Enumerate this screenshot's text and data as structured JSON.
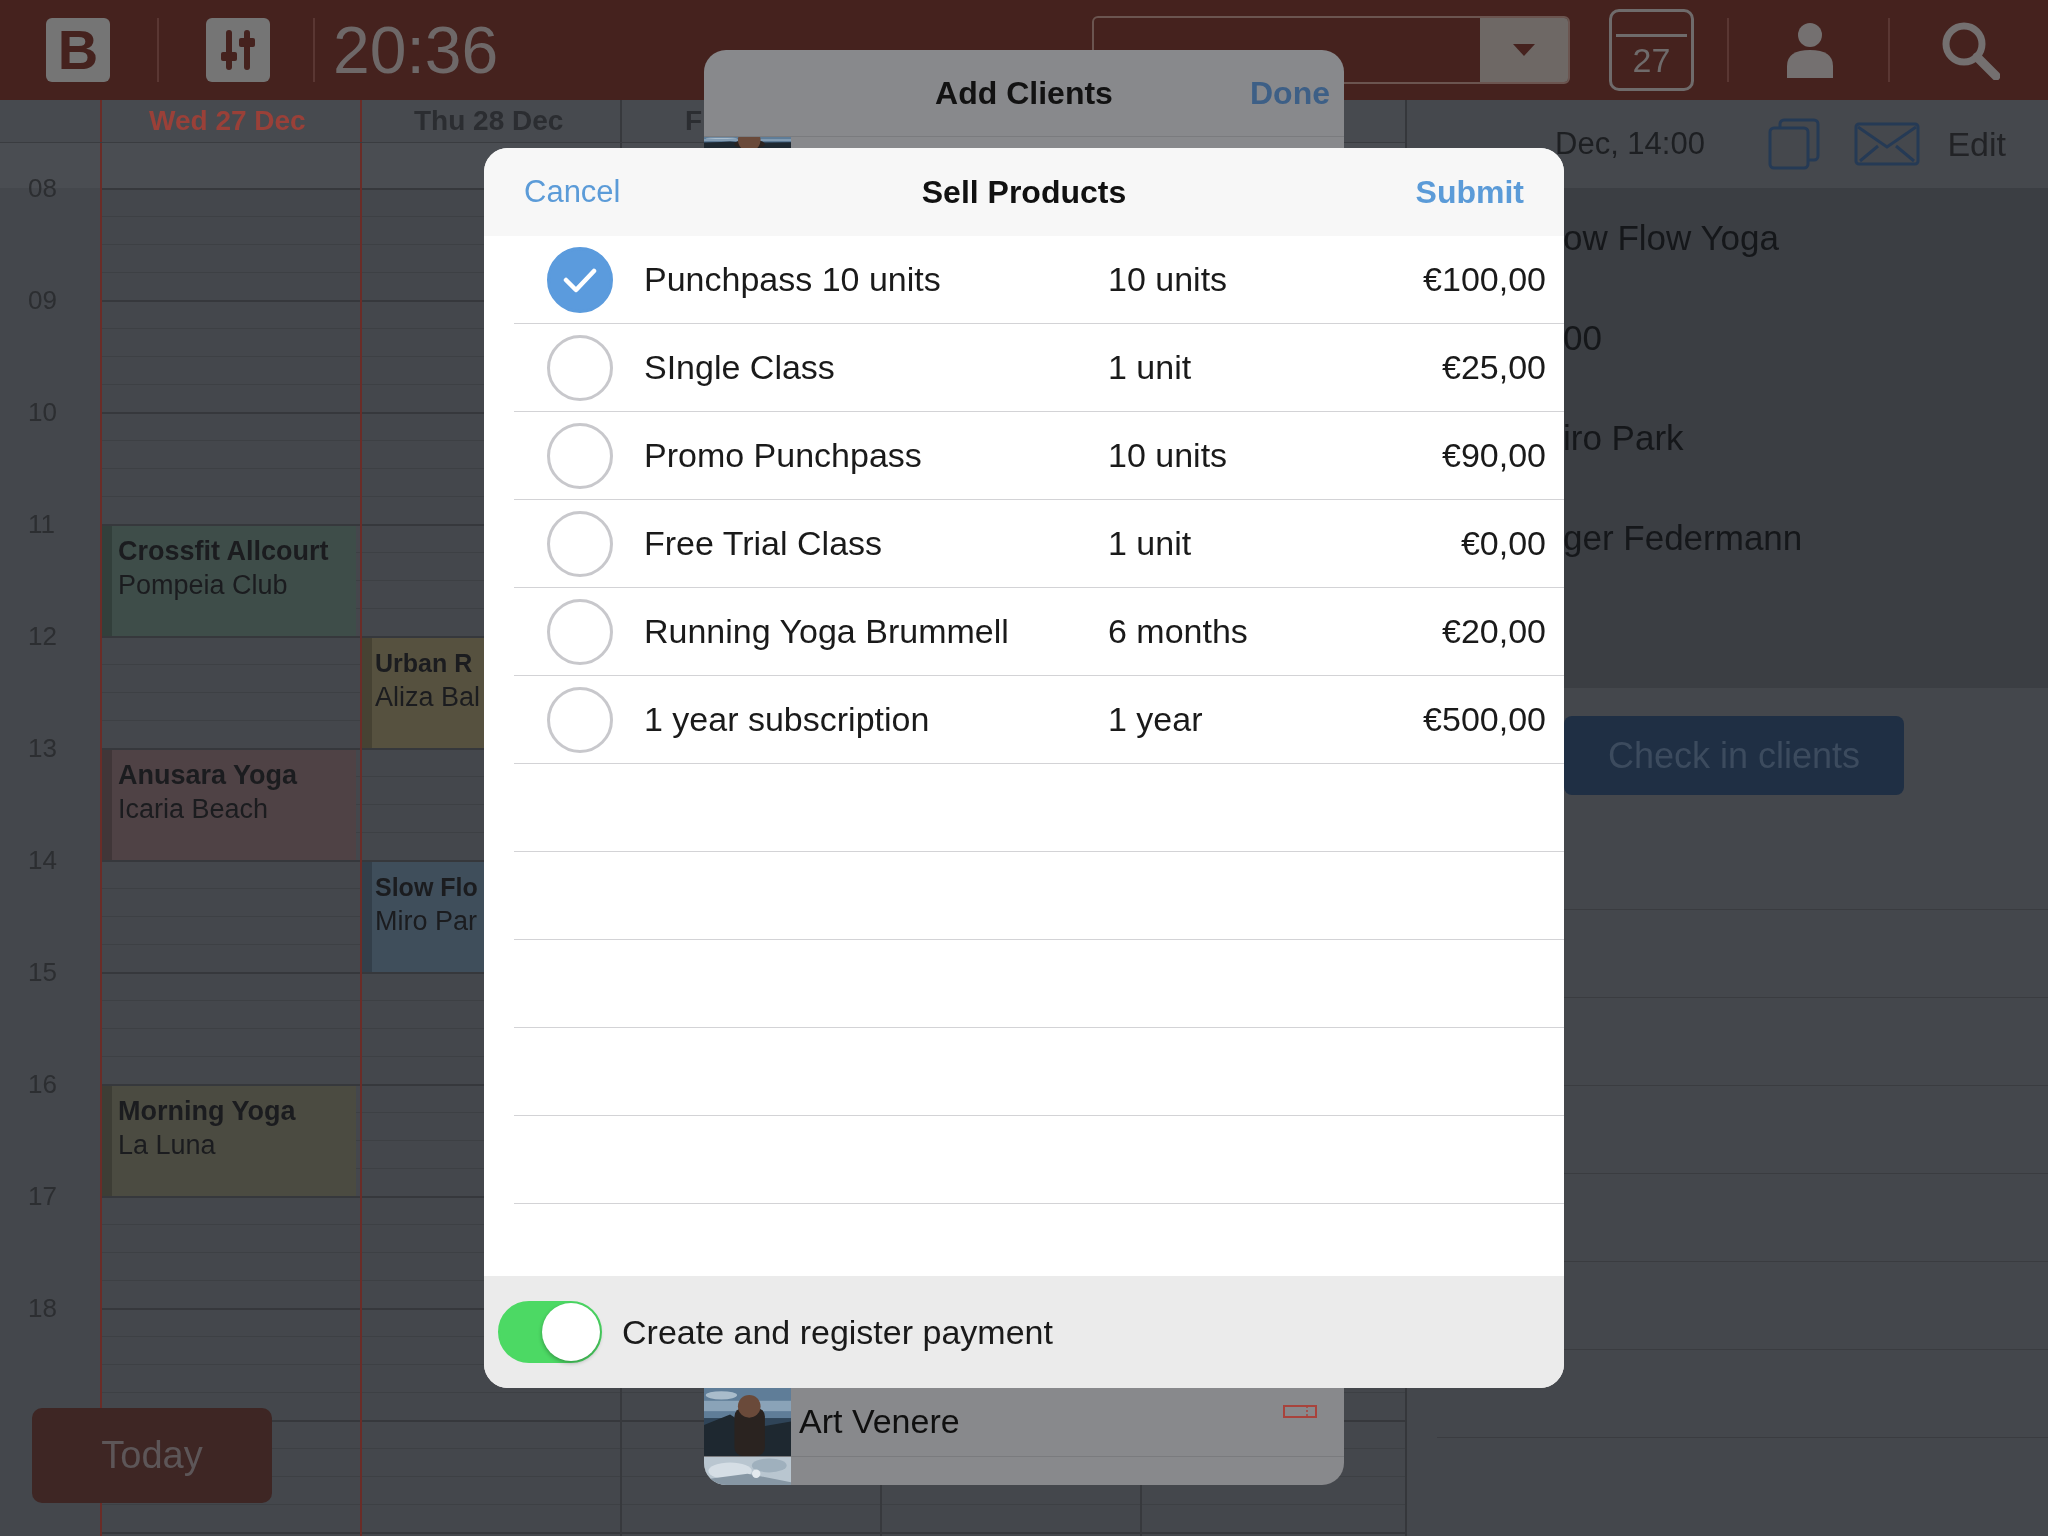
{
  "top_bar": {
    "logo_letter": "B",
    "time": "20:36",
    "calendar_day": "27"
  },
  "calendar": {
    "days": [
      {
        "label": "Wed 27 Dec",
        "today": true,
        "events": [
          {
            "title": "Crossfit Allcourt",
            "place": "Pompeia Club",
            "color": "#3e4d49"
          },
          {
            "title": "Anusara Yoga",
            "place": "Icaria Beach",
            "color": "#4f4245"
          },
          {
            "title": "Morning Yoga",
            "place": "La Luna",
            "color": "#4b4b41"
          }
        ]
      },
      {
        "label": "Thu 28 Dec",
        "today": false,
        "events": [
          {
            "title": "Urban R",
            "place": "Aliza Bal",
            "color": "#56513f"
          },
          {
            "title": "Slow Flo",
            "place": "Miro Par",
            "color": "#3f4e5b"
          }
        ]
      },
      {
        "label": "F",
        "today": false
      }
    ],
    "hours": [
      "08",
      "09",
      "10",
      "11",
      "12",
      "13",
      "14",
      "15",
      "16",
      "17",
      "18"
    ],
    "today_button": "Today"
  },
  "event_detail": {
    "heading": "Dec, 14:00",
    "edit": "Edit",
    "details": [
      "ow Flow Yoga",
      "00",
      "iro Park",
      "ger Federmann"
    ],
    "check_in_button": "Check in clients"
  },
  "add_clients": {
    "title": "Add Clients",
    "done": "Done",
    "client": {
      "name": "Art Venere"
    }
  },
  "sell_products": {
    "title": "Sell Products",
    "cancel": "Cancel",
    "submit": "Submit",
    "products": [
      {
        "name": "Punchpass 10 units",
        "amount": "10 units",
        "price": "€100,00",
        "selected": true
      },
      {
        "name": "SIngle Class",
        "amount": "1 unit",
        "price": "€25,00",
        "selected": false
      },
      {
        "name": "Promo Punchpass",
        "amount": "10 units",
        "price": "€90,00",
        "selected": false
      },
      {
        "name": "Free Trial Class",
        "amount": "1 unit",
        "price": "€0,00",
        "selected": false
      },
      {
        "name": "Running Yoga Brummell",
        "amount": "6 months",
        "price": "€20,00",
        "selected": false
      },
      {
        "name": "1 year subscription",
        "amount": "1 year",
        "price": "€500,00",
        "selected": false
      }
    ],
    "payment_toggle": {
      "label": "Create and register payment",
      "on": true
    }
  }
}
